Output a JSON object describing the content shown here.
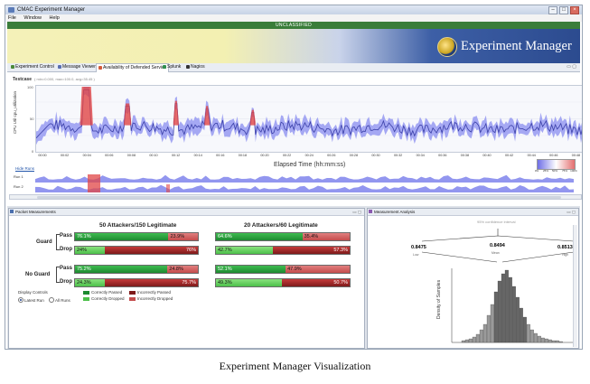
{
  "window": {
    "title": "CMAC Experiment Manager"
  },
  "menu": [
    "File",
    "Window",
    "Help"
  ],
  "classification": "UNCLASSIFIED",
  "banner": {
    "app_title": "Experiment Manager"
  },
  "tabs": [
    {
      "label": "Experiment Control",
      "icon": "experiment-icon"
    },
    {
      "label": "Message Viewer",
      "icon": "message-icon"
    },
    {
      "label": "Availability of Defended Service",
      "icon": "chart-icon"
    },
    {
      "label": "Splunk",
      "icon": "splunk-icon"
    },
    {
      "label": "Nagios",
      "icon": "nagios-icon"
    }
  ],
  "timeseries": {
    "testcase_label": "Testcase",
    "stats": "( min=0.000, max=100.0, avg=35.45 )",
    "ylabel": "CPU Util cpu_utilization",
    "yticks": [
      "100",
      "50",
      "0"
    ],
    "xlabel": "Elapsed Time (hh:mm:ss)",
    "xticks": [
      "00:00",
      "00:02",
      "00:04",
      "00:06",
      "00:08",
      "00:10",
      "00:12",
      "00:14",
      "00:16",
      "00:18",
      "00:20",
      "00:22",
      "00:24",
      "00:26",
      "00:28",
      "00:30",
      "00:32",
      "00:34",
      "00:36",
      "00:38",
      "00:40",
      "00:42",
      "00:44",
      "00:46",
      "00:48"
    ],
    "hide_runs": "Hide Runs",
    "runs": [
      "Run 1",
      "Run 2"
    ],
    "legend_scale": [
      "0%",
      "25%",
      "50%",
      "75%",
      "100%"
    ],
    "colors": {
      "band": "#7a7fe6",
      "line": "#3a3fa8",
      "hot": "#e04545"
    }
  },
  "packet_panel": {
    "title": "Packet Measurements",
    "group_headers": [
      "50 Attackers/150 Legitimate",
      "20 Attackers/60 Legitimate"
    ],
    "rows": [
      {
        "group": "Guard",
        "type": "Pass",
        "g50": "76.1%",
        "r50": "23.9%",
        "g20": "64.6%",
        "r20": "35.4%"
      },
      {
        "group": "Guard",
        "type": "Drop",
        "g50": "24%",
        "r50": "76%",
        "g20": "42.7%",
        "r20": "57.3%"
      },
      {
        "group": "No Guard",
        "type": "Pass",
        "g50": "75.2%",
        "r50": "24.8%",
        "g20": "52.1%",
        "r20": "47.9%"
      },
      {
        "group": "No Guard",
        "type": "Drop",
        "g50": "24.3%",
        "r50": "75.7%",
        "g20": "49.3%",
        "r20": "50.7%"
      }
    ],
    "values": {
      "g50": [
        76.1,
        24.0,
        75.2,
        24.3
      ],
      "g20": [
        64.6,
        42.7,
        52.1,
        49.3
      ]
    },
    "display_controls": "Display Controls",
    "radio": [
      {
        "label": "Latest Run",
        "checked": true
      },
      {
        "label": "All Runs",
        "checked": false
      }
    ],
    "legend": [
      "Correctly Passed",
      "Incorrectly Passed",
      "Correctly Dropped",
      "Incorrectly Dropped"
    ]
  },
  "measure_panel": {
    "title": "Measurement Analysis",
    "ci_title": "95% confidence interval",
    "ci_values": [
      "0.8475",
      "0.8494",
      "0.8513"
    ],
    "ci_labels": [
      "Low",
      "Mean",
      "High"
    ],
    "ylabel": "Density of Samples"
  },
  "caption": "Experiment Manager Visualization"
}
